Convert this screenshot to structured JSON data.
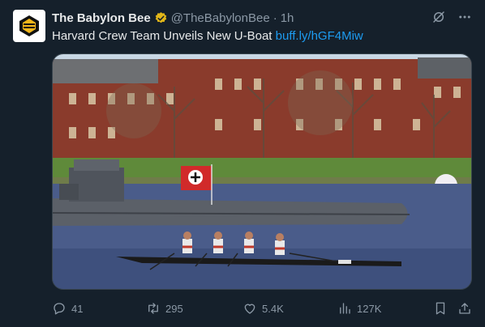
{
  "tweet": {
    "author_name": "The Babylon Bee",
    "handle": "@TheBabylonBee",
    "separator": "·",
    "time": "1h",
    "text": "Harvard Crew Team Unveils New U-Boat",
    "link": "buff.ly/hGF4Miw"
  },
  "actions": {
    "replies": "41",
    "retweets": "295",
    "likes": "5.4K",
    "views": "127K"
  },
  "icons": {
    "avatar": "babylon-bee-logo",
    "verified": "verified-badge-icon",
    "grok": "grok-icon",
    "more": "more-icon",
    "reply": "reply-icon",
    "retweet": "retweet-icon",
    "like": "heart-icon",
    "views": "views-icon",
    "bookmark": "bookmark-icon",
    "share": "share-icon"
  },
  "colors": {
    "background": "#15202b",
    "accent": "#1d9bf0",
    "verified": "#e2b719",
    "muted": "#8b98a5"
  }
}
